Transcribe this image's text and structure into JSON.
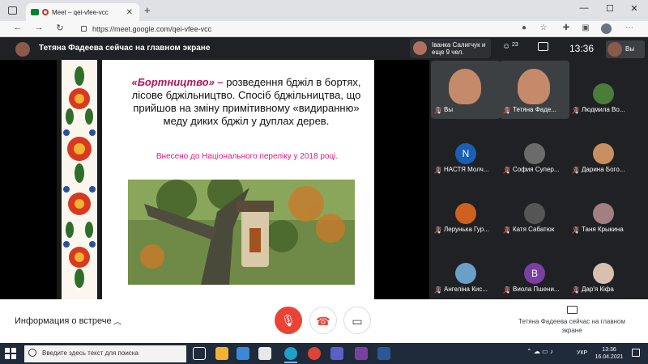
{
  "browser": {
    "tab_title": "Meet – qei-vfee-vcc",
    "tab_close": "✕",
    "new_tab": "+",
    "url": "https://meet.google.com/qei-vfee-vcc",
    "win_minimize": "—",
    "win_maximize": "☐",
    "win_close": "✕"
  },
  "meet_header": {
    "presenter_title": "Тетяна Фадеева сейчас на главном экране",
    "notification": "Іванка Салигчук и еще 9 чел.",
    "people_count": "23",
    "clock": "13:36",
    "self_label": "Вы"
  },
  "slide": {
    "highlight": "«Бортництво» –",
    "body": " розведення бджіл в бортях, лісове бджільництво. Спосіб бджільництва, що прийшов на зміну примітивному «видиранню» меду диких бджіл у дуплах дерев.",
    "note": "Внесено до Національного переліку у 2018 році."
  },
  "participants": [
    {
      "name": "Вы",
      "type": "video"
    },
    {
      "name": "Тетяна Фаде...",
      "type": "video"
    },
    {
      "name": "Людмила Во...",
      "type": "avatar",
      "color": "#4a7c3a"
    },
    {
      "name": "НАСТЯ Молч...",
      "type": "letter",
      "letter": "N",
      "color": "#1a5fb4"
    },
    {
      "name": "София Супер...",
      "type": "avatar",
      "color": "#6b6b6b"
    },
    {
      "name": "Дарина Бого...",
      "type": "avatar",
      "color": "#c89060"
    },
    {
      "name": "Лерунька Гур...",
      "type": "avatar",
      "color": "#d06020"
    },
    {
      "name": "Катя Сабатюк",
      "type": "avatar",
      "color": "#555555"
    },
    {
      "name": "Таня Крыкина",
      "type": "avatar",
      "color": "#a08080"
    },
    {
      "name": "Ангеліна Кис...",
      "type": "avatar",
      "color": "#6aa0c8"
    },
    {
      "name": "Виола Пшени...",
      "type": "letter",
      "letter": "B",
      "color": "#7b3fa0"
    },
    {
      "name": "Дар'я Кіфа",
      "type": "avatar",
      "color": "#d8c0b0"
    }
  ],
  "bottom_bar": {
    "meeting_info": "Информация о встрече",
    "presenting_text": "Тетяна Фадеева сейчас на главном экране"
  },
  "taskbar": {
    "search_placeholder": "Введите здесь текст для поиска",
    "language": "УКР",
    "time": "13:36",
    "date": "16.04.2021"
  }
}
